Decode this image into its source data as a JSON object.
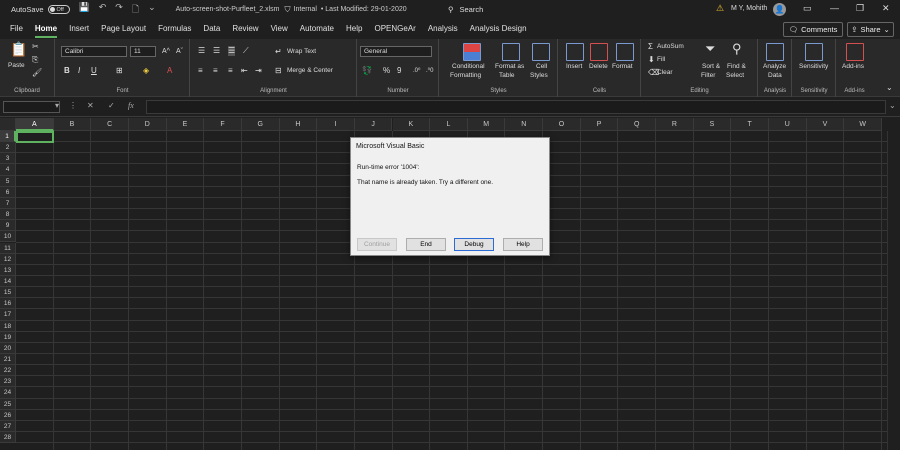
{
  "title_bar": {
    "autosave_label": "AutoSave",
    "autosave_state": "Off",
    "doc_name": "Auto-screen-shot-Purfleet_2.xlsm",
    "sensitivity": "Internal",
    "last_modified": "• Last Modified: 29-01-2020",
    "search_placeholder": "Search",
    "user_name": "M Y, Mohith",
    "avatar_initial": "👤"
  },
  "ribbon_tabs": [
    "File",
    "Home",
    "Insert",
    "Page Layout",
    "Formulas",
    "Data",
    "Review",
    "View",
    "Automate",
    "Help",
    "OPENGeAr",
    "Analysis",
    "Analysis Design"
  ],
  "buttons": {
    "comments": "Comments",
    "share": "Share"
  },
  "clipboard": {
    "paste": "Paste",
    "label": "Clipboard"
  },
  "font": {
    "name": "Calibri",
    "size": "11",
    "label": "Font"
  },
  "alignment": {
    "wrap": "Wrap Text",
    "merge": "Merge & Center",
    "label": "Alignment"
  },
  "number": {
    "format": "General",
    "label": "Number"
  },
  "styles": {
    "conditional": "Conditional",
    "conditional2": "Formatting",
    "format_table": "Format as",
    "format_table2": "Table",
    "cell_styles": "Cell",
    "cell_styles2": "Styles",
    "label": "Styles"
  },
  "cells": {
    "insert": "Insert",
    "delete": "Delete",
    "format": "Format",
    "label": "Cells"
  },
  "editing": {
    "autosum": "AutoSum",
    "fill": "Fill",
    "clear": "Clear",
    "sort": "Sort &",
    "sort2": "Filter",
    "find": "Find &",
    "find2": "Select",
    "label": "Editing"
  },
  "analysis": {
    "analyze": "Analyze",
    "analyze2": "Data",
    "label": "Analysis"
  },
  "sensitivity": {
    "btn": "Sensitivity",
    "label": "Sensitivity"
  },
  "addins": {
    "btn": "Add-ins",
    "label": "Add-ins"
  },
  "columns": [
    "A",
    "B",
    "C",
    "D",
    "E",
    "F",
    "G",
    "H",
    "I",
    "J",
    "K",
    "L",
    "M",
    "N",
    "O",
    "P",
    "Q",
    "R",
    "S",
    "T",
    "U",
    "V",
    "W"
  ],
  "rows": [
    "1",
    "2",
    "3",
    "4",
    "5",
    "6",
    "7",
    "8",
    "9",
    "10",
    "11",
    "12",
    "13",
    "14",
    "15",
    "16",
    "17",
    "18",
    "19",
    "20",
    "21",
    "22",
    "23",
    "24",
    "25",
    "26",
    "27",
    "28"
  ],
  "dialog": {
    "title": "Microsoft Visual Basic",
    "error": "Run-time error '1004':",
    "message": "That name is already taken. Try a different one.",
    "continue": "Continue",
    "end": "End",
    "debug": "Debug",
    "help": "Help"
  }
}
